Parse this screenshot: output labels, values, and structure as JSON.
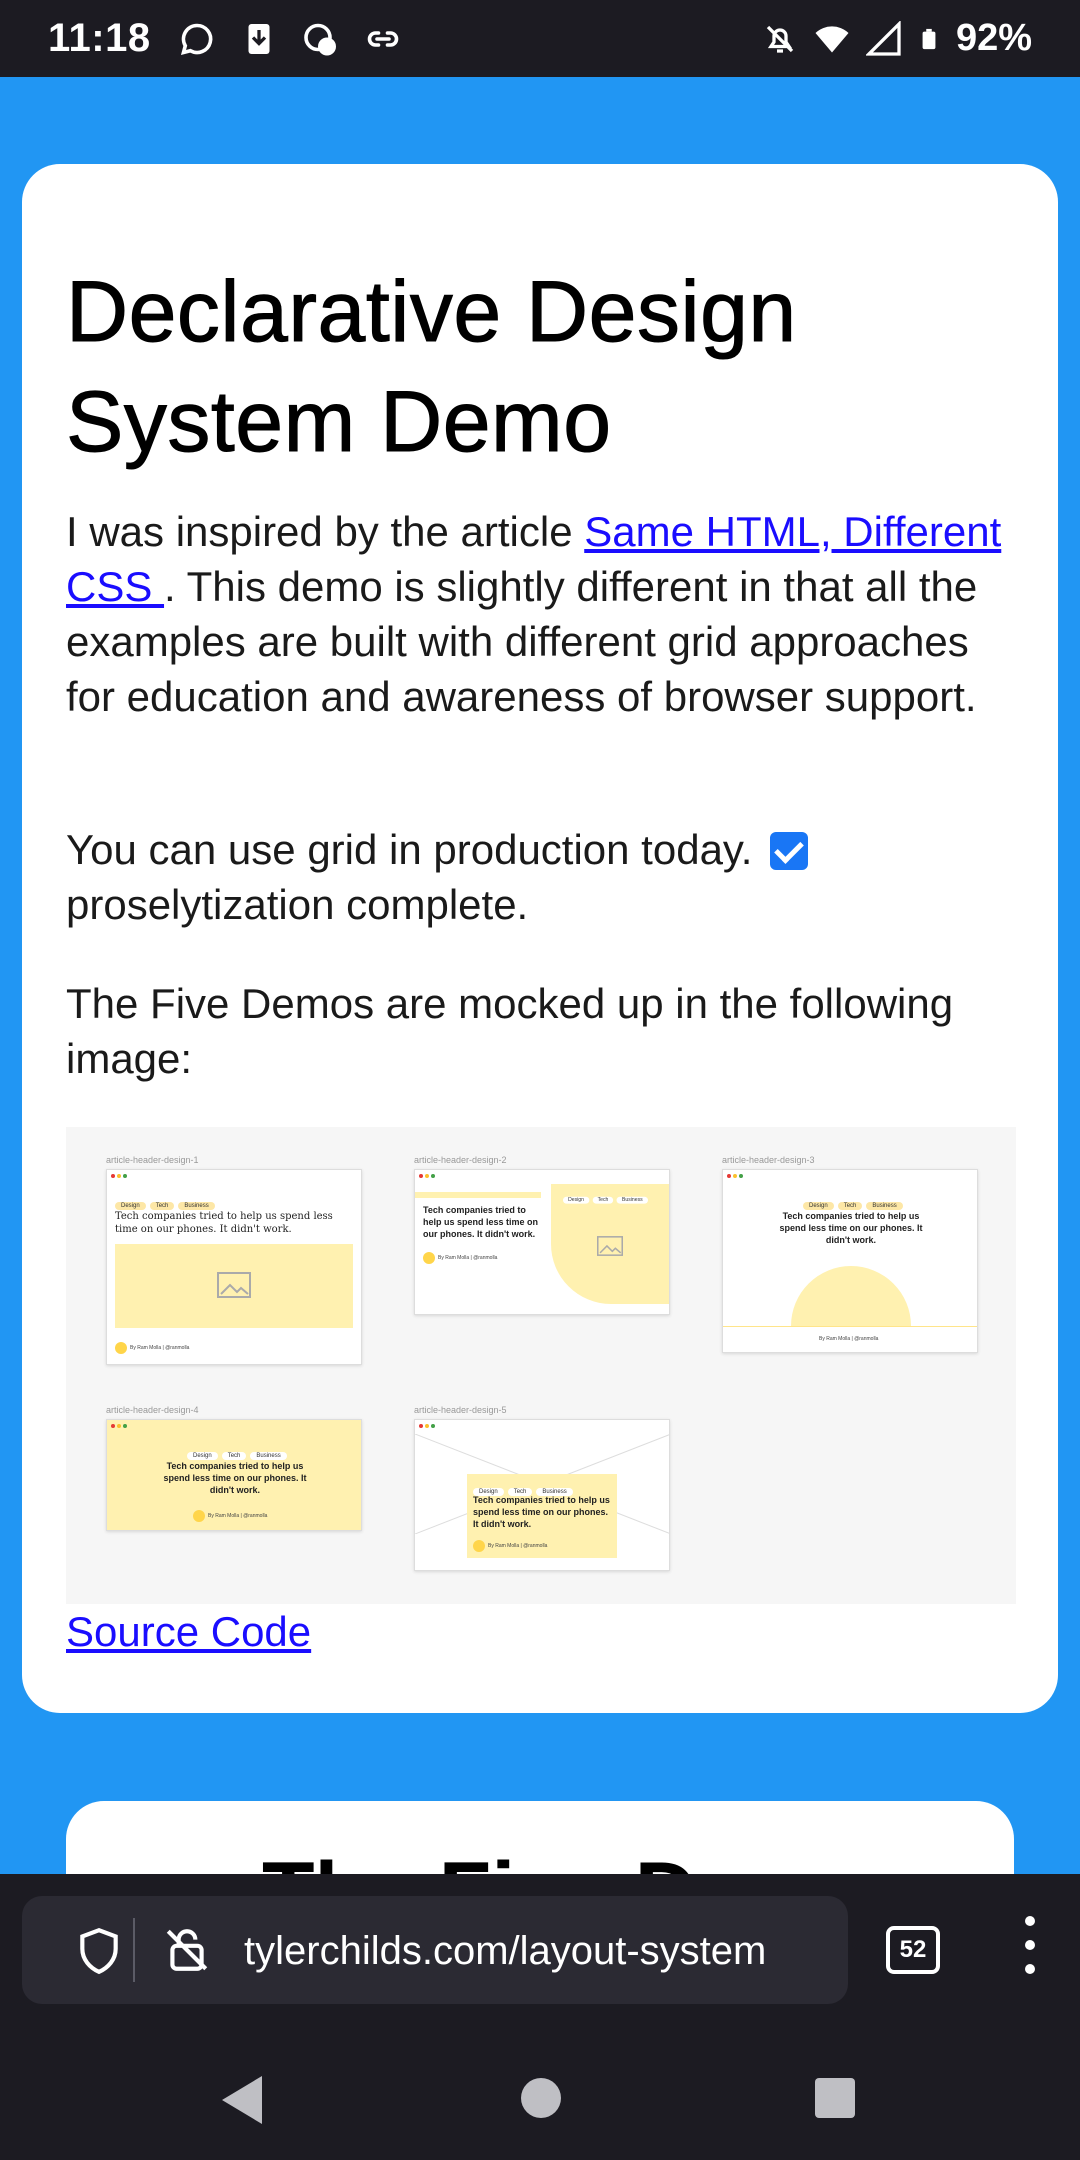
{
  "status_bar": {
    "time": "11:18",
    "battery": "92%",
    "left_icons": [
      "chat-bubble-icon",
      "download-icon",
      "sync-icon",
      "link-icon"
    ],
    "right_icons": [
      "bell-off-icon",
      "wifi-icon",
      "signal-icon",
      "battery-icon"
    ]
  },
  "article": {
    "title": "Declarative Design System Demo",
    "p1_before": "I was inspired by the article ",
    "p1_link": "Same HTML, Different CSS ",
    "p1_after": ". This demo is slightly different in that all the examples are built with different grid approaches for education and awareness of browser support.",
    "p2_before": "You can use grid in production today.",
    "p2_after": "proselytization complete.",
    "p3": "The Five Demos are mocked up in the following image:",
    "source_link": "Source Code",
    "next_card_title": "The Five Demos"
  },
  "mockup": {
    "labels": [
      "article-header-design-1",
      "article-header-design-2",
      "article-header-design-3",
      "article-header-design-4",
      "article-header-design-5"
    ],
    "chips": [
      "Design",
      "Tech",
      "Business"
    ],
    "headline": "Tech companies tried to help us spend less time on our phones. It didn't work.",
    "byline": "By Ram Molla  |  @ranmolla"
  },
  "browser": {
    "url": "tylerchilds.com/layout-system",
    "tab_count": "52"
  },
  "colors": {
    "background": "#2196f3",
    "link": "#1a0dff",
    "checkbox": "#1976f5",
    "mock_yellow": "#fff1b0"
  }
}
